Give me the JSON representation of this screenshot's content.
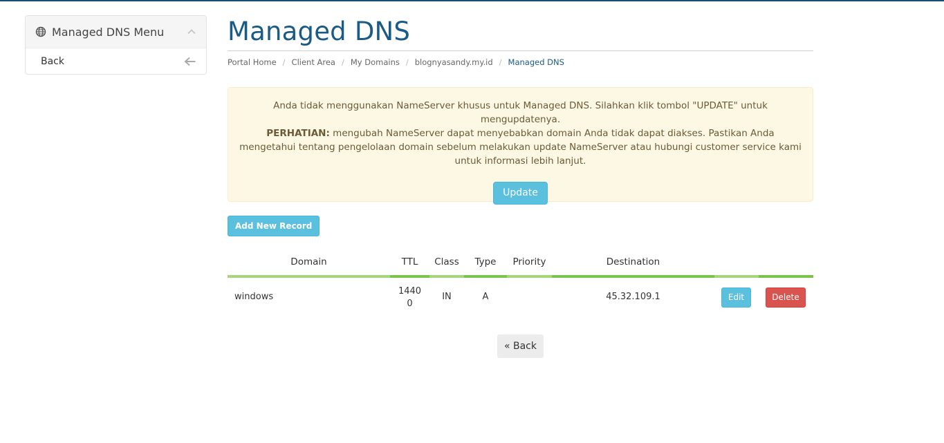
{
  "sidebar": {
    "title": "Managed DNS Menu",
    "items": [
      {
        "label": "Back"
      }
    ]
  },
  "main": {
    "title": "Managed DNS",
    "breadcrumb": [
      "Portal Home",
      "Client Area",
      "My Domains",
      "blognyasandy.my.id",
      "Managed DNS"
    ],
    "alert": {
      "line1": "Anda tidak menggunakan NameServer khusus untuk Managed DNS. Silahkan klik tombol \"UPDATE\" untuk mengupdatenya.",
      "warning_label": "PERHATIAN:",
      "warning_text": " mengubah NameServer dapat menyebabkan domain Anda tidak dapat diakses. Pastikan Anda mengetahui tentang pengelolaan domain sebelum melakukan update NameServer atau hubungi customer service kami untuk informasi lebih lanjut.",
      "update_label": "Update"
    },
    "add_record_label": "Add New Record",
    "table": {
      "columns": [
        "Domain",
        "TTL",
        "Class",
        "Type",
        "Priority",
        "Destination"
      ],
      "rows": [
        {
          "domain": "windows",
          "ttl_line1": "1440",
          "ttl_line2": "0",
          "class": "IN",
          "type": "A",
          "priority": "",
          "destination": "45.32.109.1",
          "edit_label": "Edit",
          "delete_label": "Delete"
        }
      ]
    },
    "back_label": "« Back"
  },
  "colors": {
    "accent": "#1a5a86",
    "info_button": "#5bc0de",
    "danger_button": "#d9534f",
    "alert_bg": "#fcf8e3",
    "table_bar_dark": "#7dc24b",
    "table_bar_light": "#a6d67c"
  }
}
